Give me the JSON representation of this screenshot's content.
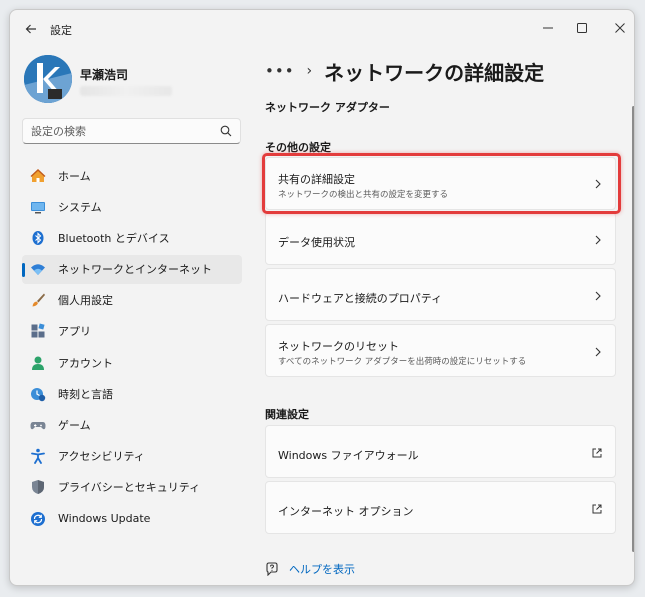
{
  "window": {
    "app_title": "設定"
  },
  "profile": {
    "name": "早瀬浩司"
  },
  "search": {
    "placeholder": "設定の検索"
  },
  "sidebar": {
    "items": [
      {
        "label": "ホーム",
        "icon": "home-icon"
      },
      {
        "label": "システム",
        "icon": "system-icon"
      },
      {
        "label": "Bluetooth とデバイス",
        "icon": "bluetooth-icon"
      },
      {
        "label": "ネットワークとインターネット",
        "icon": "wifi-icon",
        "active": true
      },
      {
        "label": "個人用設定",
        "icon": "brush-icon"
      },
      {
        "label": "アプリ",
        "icon": "apps-icon"
      },
      {
        "label": "アカウント",
        "icon": "account-icon"
      },
      {
        "label": "時刻と言語",
        "icon": "time-language-icon"
      },
      {
        "label": "ゲーム",
        "icon": "gamepad-icon"
      },
      {
        "label": "アクセシビリティ",
        "icon": "accessibility-icon"
      },
      {
        "label": "プライバシーとセキュリティ",
        "icon": "shield-icon"
      },
      {
        "label": "Windows Update",
        "icon": "windows-update-icon"
      }
    ]
  },
  "main": {
    "breadcrumb_dots": "•••",
    "breadcrumb_sep": "›",
    "title": "ネットワークの詳細設定",
    "section_adapters": "ネットワーク アダプター",
    "section_other": "その他の設定",
    "cards": [
      {
        "title": "共有の詳細設定",
        "subtitle": "ネットワークの検出と共有の設定を変更する"
      },
      {
        "title": "データ使用状況"
      },
      {
        "title": "ハードウェアと接続のプロパティ"
      },
      {
        "title": "ネットワークのリセット",
        "subtitle": "すべてのネットワーク アダプターを出荷時の設定にリセットする"
      }
    ],
    "section_related": "関連設定",
    "related": [
      {
        "title": "Windows ファイアウォール"
      },
      {
        "title": "インターネット オプション"
      }
    ],
    "help": "ヘルプを表示"
  },
  "colors": {
    "accent": "#0067c0",
    "highlight": "#e33c3c"
  }
}
